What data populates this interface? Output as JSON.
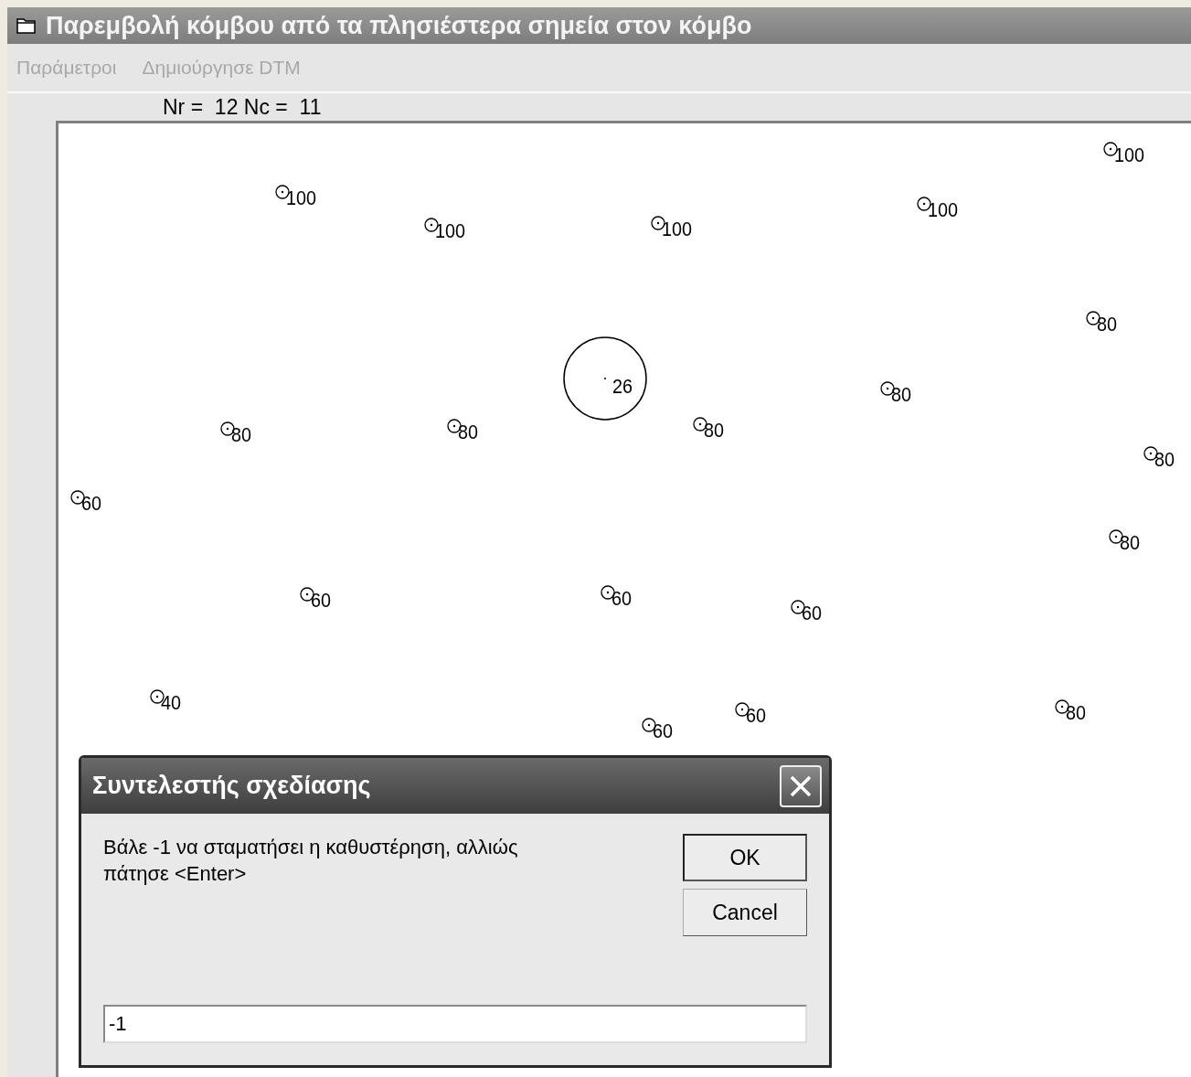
{
  "window": {
    "title": "Παρεμβολή κόμβου από τα  πλησιέστερα σημεία στον κόμβο"
  },
  "menu": [
    {
      "label": "Παράμετροι",
      "disabled": true
    },
    {
      "label": "Δημιούργησε DTM",
      "disabled": true
    }
  ],
  "grid_info": "Nr =  12 Nc =  11",
  "canvas": {
    "points": [
      {
        "value": "100"
      },
      {
        "value": "100"
      },
      {
        "value": "100"
      },
      {
        "value": "100"
      },
      {
        "value": "100"
      },
      {
        "value": "80"
      },
      {
        "value": "80"
      },
      {
        "value": "80"
      },
      {
        "value": "80"
      },
      {
        "value": "80"
      },
      {
        "value": "80"
      },
      {
        "value": "80"
      },
      {
        "value": "60"
      },
      {
        "value": "60"
      },
      {
        "value": "60"
      },
      {
        "value": "60"
      },
      {
        "value": "40"
      },
      {
        "value": "60"
      },
      {
        "value": "60"
      },
      {
        "value": "80"
      }
    ],
    "current_node": {
      "value": "26"
    }
  },
  "dialog": {
    "title": "Συντελεστής σχεδίασης",
    "message": "Βάλε -1 να σταματήσει η καθυστέρηση, αλλιώς πάτησε <Enter>",
    "buttons": [
      {
        "label": "OK",
        "default": true
      },
      {
        "label": "Cancel",
        "default": false
      }
    ],
    "input": {
      "value": "-1"
    }
  }
}
